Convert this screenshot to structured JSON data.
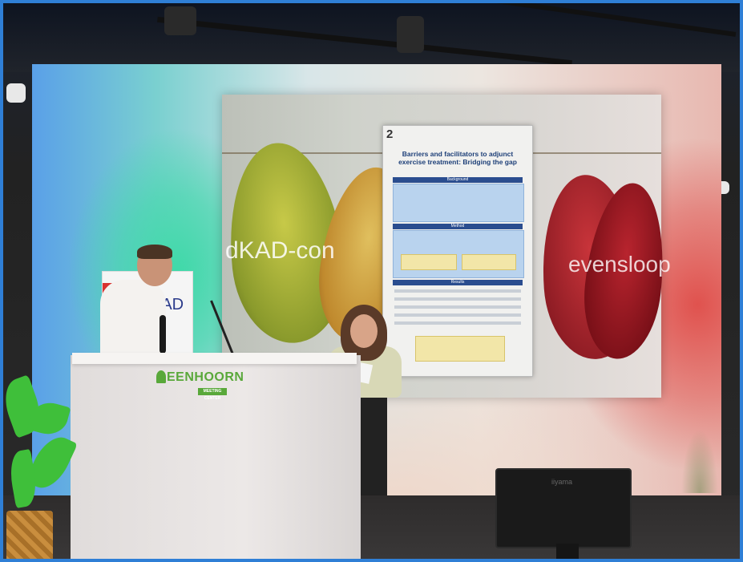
{
  "scene": "conference stage",
  "screen": {
    "left_text": "dKAD-con",
    "right_text": "evensloop",
    "poster": {
      "number": "2",
      "title": "Barriers and facilitators to adjunct exercise treatment: Bridging the gap",
      "sections": [
        "Background",
        "Method",
        "Results"
      ]
    }
  },
  "banner": {
    "text": "KAD"
  },
  "podium": {
    "logo_text": "EENHOORN",
    "logo_sub": "MEETING CENTER"
  },
  "monitor": {
    "brand": "iiyama"
  }
}
